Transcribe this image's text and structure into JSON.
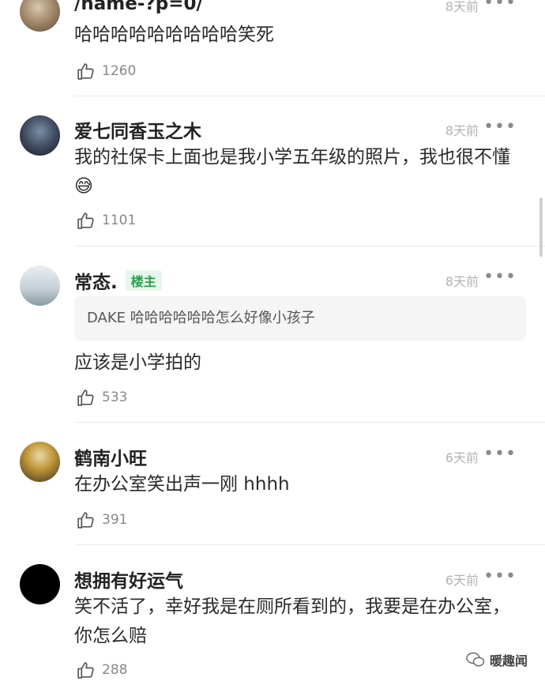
{
  "comments": [
    {
      "username": "/name-?p=0/",
      "time": "8天前",
      "text": "哈哈哈哈哈哈哈哈哈笑死",
      "likes": "1260"
    },
    {
      "username": "爱七同香玉之木",
      "time": "8天前",
      "text": "我的社保卡上面也是我小学五年级的照片，我也很不懂😅",
      "likes": "1101"
    },
    {
      "username": "常态.",
      "badge": "楼主",
      "time": "8天前",
      "quote": "DAKE 哈哈哈哈哈哈怎么好像小孩子",
      "text": "应该是小学拍的",
      "likes": "533"
    },
    {
      "username": "鹤南小旺",
      "time": "6天前",
      "text": "在办公室笑出声一刚 hhhh",
      "likes": "391"
    },
    {
      "username": "想拥有好运气",
      "time": "6天前",
      "text": "笑不活了，幸好我是在厕所看到的，我要是在办公室，你怎么赔",
      "likes": "288"
    }
  ],
  "more_icon": "ellipsis-icon",
  "like_icon": "thumbs-up-icon",
  "watermark": "暖趣闻",
  "colors": {
    "badge_text": "#23a14a",
    "badge_bg": "#e6f6ea",
    "time": "#b3b3b3"
  }
}
